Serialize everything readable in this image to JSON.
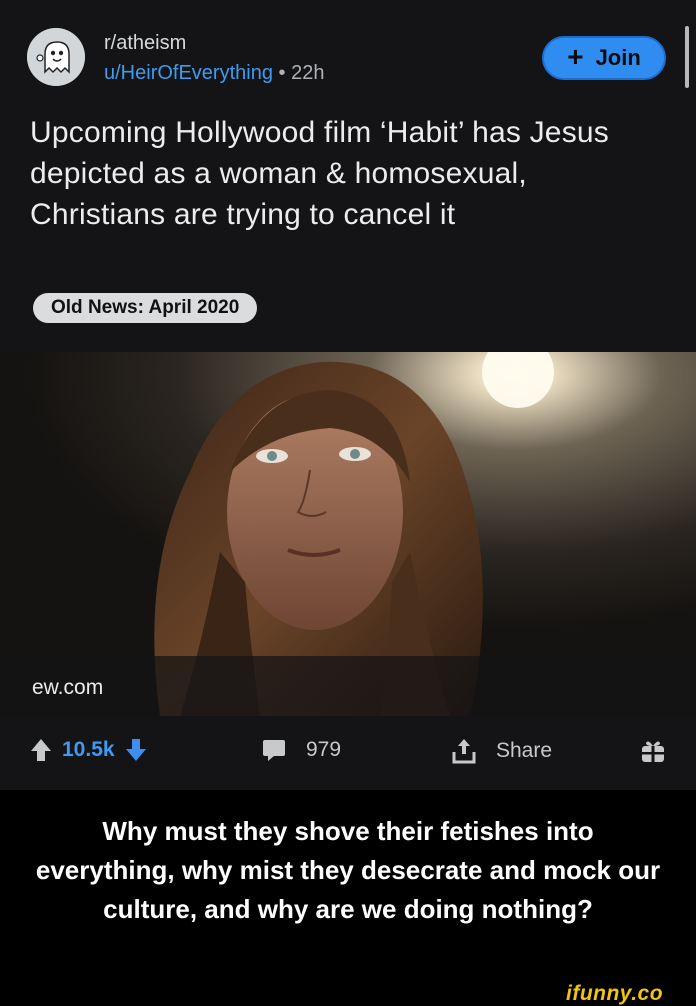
{
  "header": {
    "subreddit": "r/atheism",
    "username": "u/HeirOfEverything",
    "separator": "•",
    "age": "22h",
    "join_label": "Join",
    "join_icon": "plus-icon"
  },
  "post": {
    "title": "Upcoming Hollywood film ‘Habit’ has Jesus depicted as a woman & homosexual, Christians are trying to cancel it",
    "flair": "Old News: April 2020",
    "link_domain": "ew.com"
  },
  "actions": {
    "upvote_icon": "arrow-up-icon",
    "vote_count": "10.5k",
    "downvote_icon": "arrow-down-icon",
    "comment_icon": "comment-icon",
    "comment_count": "979",
    "share_icon": "share-icon",
    "share_label": "Share",
    "award_icon": "gift-icon"
  },
  "caption": "Why must they shove their fetishes into everything, why mist they desecrate and mock our culture, and why are we doing nothing?",
  "watermark": "ifunny.co",
  "colors": {
    "accent": "#2f8df2",
    "link": "#3e9bf0",
    "background": "#141416",
    "watermark": "#f1c40f"
  }
}
